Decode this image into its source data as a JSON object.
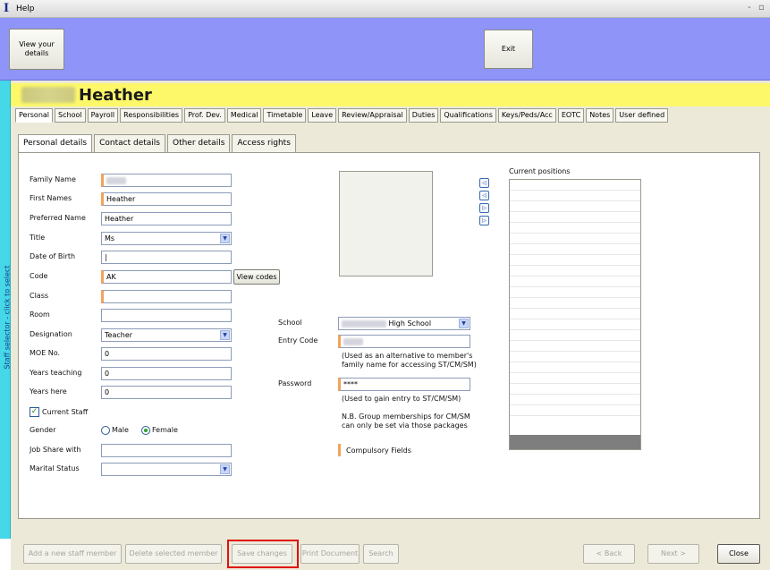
{
  "window": {
    "title": "Help",
    "minimize_glyph": "-",
    "restore_glyph": "▫"
  },
  "toolbar": {
    "view_details_label": "View your details",
    "exit_label": "Exit"
  },
  "left_strip": {
    "label": "Staff selector - click to select"
  },
  "person": {
    "name": "Heather"
  },
  "top_tabs": [
    "Personal",
    "School",
    "Payroll",
    "Responsibilities",
    "Prof. Dev.",
    "Medical",
    "Timetable",
    "Leave",
    "Review/Appraisal",
    "Duties",
    "Qualifications",
    "Keys/Peds/Acc",
    "EOTC",
    "Notes",
    "User defined"
  ],
  "sub_tabs": [
    "Personal details",
    "Contact details",
    "Other details",
    "Access rights"
  ],
  "form": {
    "family_name_label": "Family Name",
    "first_names_label": "First Names",
    "first_names_value": "Heather",
    "preferred_name_label": "Preferred Name",
    "preferred_name_value": "Heather",
    "title_label": "Title",
    "title_value": "Ms",
    "dob_label": "Date of Birth",
    "dob_value": "|",
    "code_label": "Code",
    "code_value": "AK",
    "view_codes_label": "View codes",
    "class_label": "Class",
    "room_label": "Room",
    "designation_label": "Designation",
    "designation_value": "Teacher",
    "moe_label": "MOE No.",
    "moe_value": "0",
    "years_teaching_label": "Years teaching",
    "years_teaching_value": "0",
    "years_here_label": "Years here",
    "years_here_value": "0",
    "current_staff_label": "Current Staff",
    "gender_label": "Gender",
    "male_label": "Male",
    "female_label": "Female",
    "job_share_label": "Job Share with",
    "marital_label": "Marital Status",
    "school_label": "School",
    "school_value": "High School",
    "entry_code_label": "Entry Code",
    "entry_note": "(Used as an alternative to member's family name for accessing ST/CM/SM)",
    "password_label": "Password",
    "password_value": "****",
    "password_note": "(Used to gain entry to ST/CM/SM)",
    "group_note": "N.B. Group memberships for CM/SM can only be set via those packages",
    "compulsory_label": "Compulsory Fields",
    "positions_label": "Current positions"
  },
  "footer": {
    "add_label": "Add a new staff member",
    "delete_label": "Delete selected member",
    "save_label": "Save changes",
    "print_label": "Print Document",
    "search_label": "Search",
    "back_label": "< Back",
    "next_label": "Next >",
    "close_label": "Close"
  },
  "colors": {
    "toolbar": "#8e94f8",
    "name_bar": "#fdf86a",
    "left_strip": "#44d8e8",
    "required": "#f3a35a",
    "highlight": "#e01010"
  }
}
